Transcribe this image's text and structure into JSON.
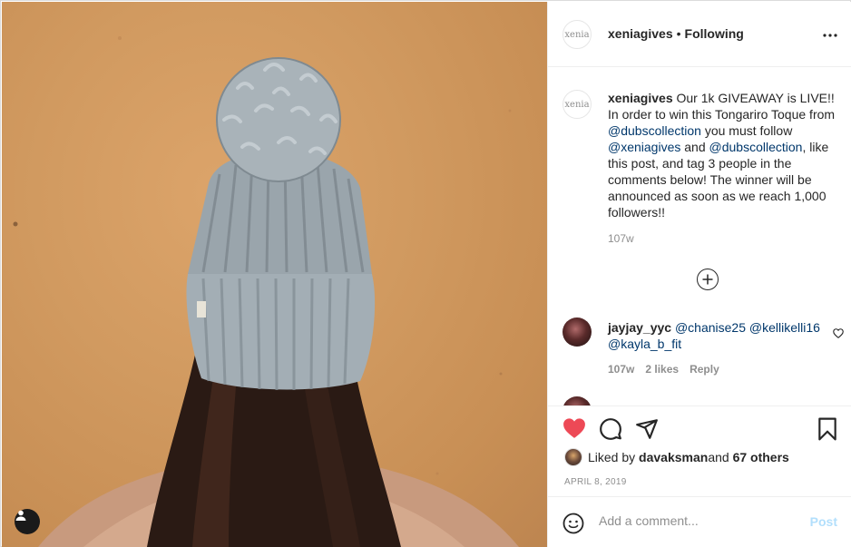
{
  "post": {
    "author_avatar_text": "xenia",
    "author": "xeniagives",
    "separator": "•",
    "follow_status": "Following",
    "more_icon": "ellipsis-icon"
  },
  "caption": {
    "username": "xeniagives",
    "text_1": " Our 1k GIVEAWAY is LIVE!! In order to win this Tongariro Toque from ",
    "mention_1": "@dubscollection",
    "text_2": " you must follow ",
    "mention_2": "@xeniagives",
    "text_3": " and ",
    "mention_3": "@dubscollection",
    "text_4": ", like this post, and tag 3 people in the comments below! The winner will be announced as soon as we reach 1,000 followers!!",
    "time": "107w"
  },
  "comments": [
    {
      "username": "jayjay_yyc",
      "mentions": [
        "@chanise25",
        "@kellikelli16",
        "@kayla_b_fit"
      ],
      "time": "107w",
      "likes": "2 likes",
      "reply": "Reply"
    }
  ],
  "actions": {
    "liked": true,
    "liked_prefix": "Liked by ",
    "liked_by": "davaksman",
    "liked_mid": " and ",
    "liked_others": "67 others",
    "date": "APRIL 8, 2019"
  },
  "add_comment": {
    "placeholder": "Add a comment...",
    "post_label": "Post"
  },
  "colors": {
    "heart": "#ed4956",
    "link": "#00376b",
    "post_disabled": "#b2dffc"
  }
}
